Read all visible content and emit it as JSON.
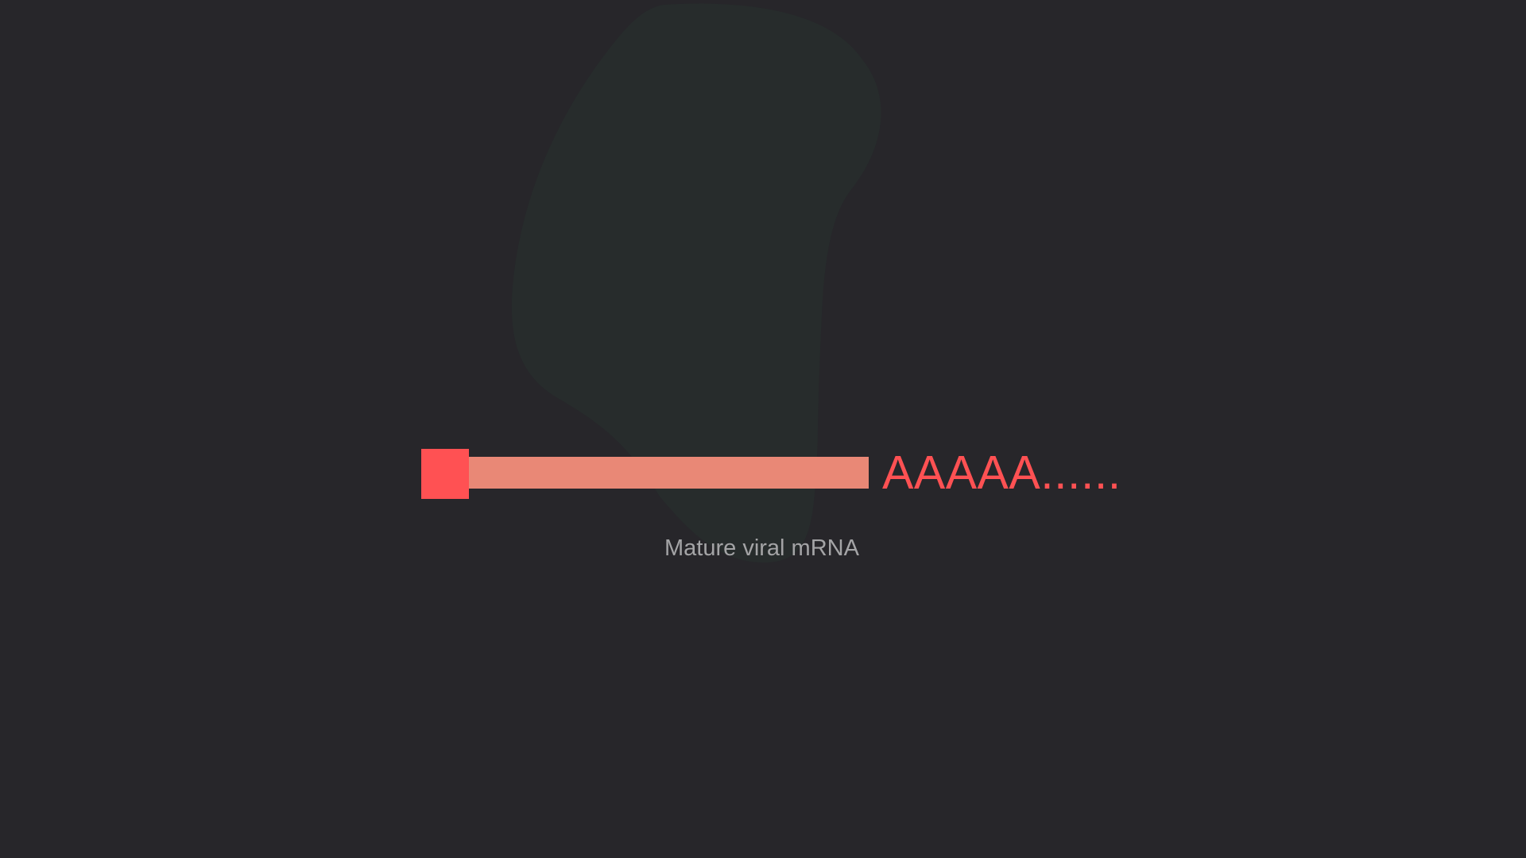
{
  "diagram": {
    "cap_icon": "five-prime-cap-square",
    "poly_a_tail": "AAAAA......",
    "label": "Mature viral mRNA"
  },
  "colors": {
    "background": "#27262a",
    "cell_blob": "#272c2c",
    "cap": "#ff5153",
    "strand": "#e98876",
    "tail_text": "#ff5153",
    "label_text": "#a4a4a6"
  }
}
